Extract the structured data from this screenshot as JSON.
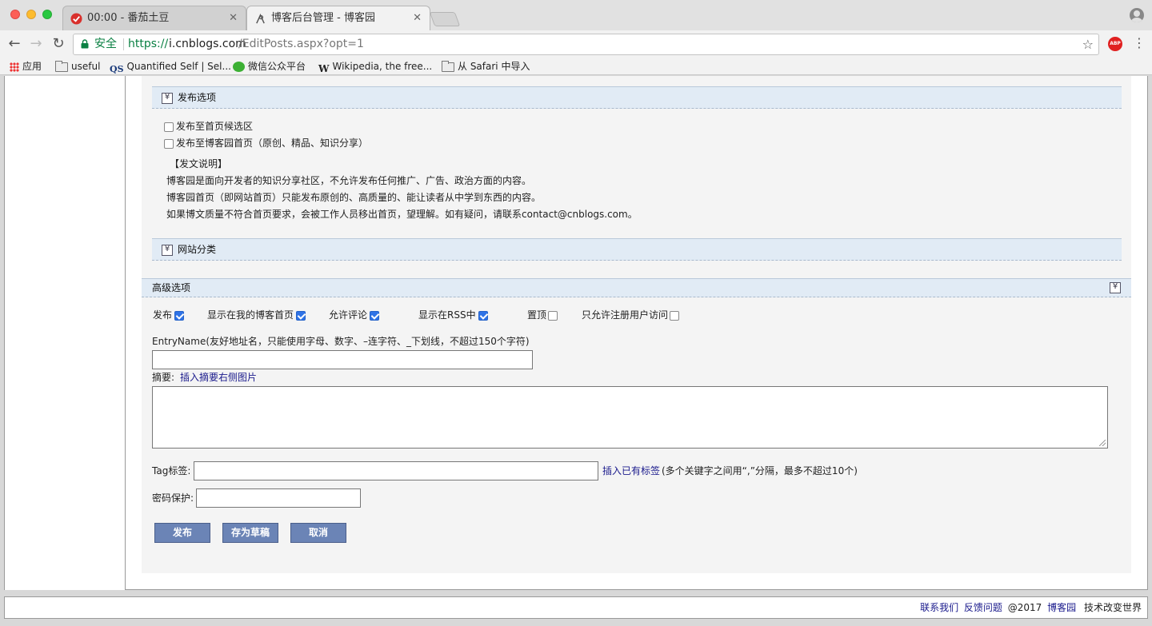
{
  "browser": {
    "tabs": [
      {
        "title": "00:00 - 番茄土豆",
        "active": false
      },
      {
        "title": "博客后台管理 - 博客园",
        "active": true
      }
    ],
    "address": {
      "secure_label": "安全",
      "scheme": "https://",
      "host": "i.cnblogs.com",
      "path": "/EditPosts.aspx?opt=1"
    },
    "extension_label": "ABP",
    "bookmarks": [
      {
        "label": "应用",
        "icon": "apps-grid-icon"
      },
      {
        "label": "useful",
        "icon": "folder-icon"
      },
      {
        "label": "Quantified Self | Sel...",
        "icon": "qs-icon",
        "icon_text": "QS"
      },
      {
        "label": "微信公众平台",
        "icon": "wechat-icon"
      },
      {
        "label": "Wikipedia, the free...",
        "icon": "wikipedia-icon",
        "icon_text": "W"
      },
      {
        "label": "从 Safari 中导入",
        "icon": "folder-icon"
      }
    ]
  },
  "publish_options": {
    "header": "发布选项",
    "checkboxes": [
      {
        "label": "发布至首页候选区",
        "checked": false
      },
      {
        "label": "发布至博客园首页（原创、精品、知识分享）",
        "checked": false
      }
    ],
    "notice_title": "【发文说明】",
    "notice_lines": [
      "博客园是面向开发者的知识分享社区，不允许发布任何推广、广告、政治方面的内容。",
      "博客园首页（即网站首页）只能发布原创的、高质量的、能让读者从中学到东西的内容。",
      "如果博文质量不符合首页要求，会被工作人员移出首页，望理解。如有疑问，请联系contact@cnblogs.com。"
    ]
  },
  "site_category": {
    "header": "网站分类"
  },
  "advanced": {
    "header": "高级选项",
    "options": [
      {
        "label": "发布",
        "checked": true
      },
      {
        "label": "显示在我的博客首页",
        "checked": true
      },
      {
        "label": "允许评论",
        "checked": true
      },
      {
        "label": "显示在RSS中",
        "checked": true
      },
      {
        "label": "置顶",
        "checked": false
      },
      {
        "label": "只允许注册用户访问",
        "checked": false
      }
    ],
    "entry_name_label": "EntryName(友好地址名，只能使用字母、数字、–连字符、_下划线，不超过150个字符)",
    "entry_name_value": "",
    "summary_label": "摘要:",
    "summary_link": "插入摘要右侧图片",
    "summary_value": "",
    "tag_label": "Tag标签:",
    "tag_value": "",
    "tag_link": "插入已有标签",
    "tag_hint": "(多个关键字之间用“,”分隔，最多不超过10个)",
    "password_label": "密码保护:",
    "password_value": ""
  },
  "buttons": {
    "publish": "发布",
    "save_draft": "存为草稿",
    "cancel": "取消"
  },
  "footer": {
    "contact": "联系我们",
    "feedback": "反馈问题",
    "copyright": "@2017",
    "site": "博客园",
    "slogan": "技术改变世界"
  }
}
